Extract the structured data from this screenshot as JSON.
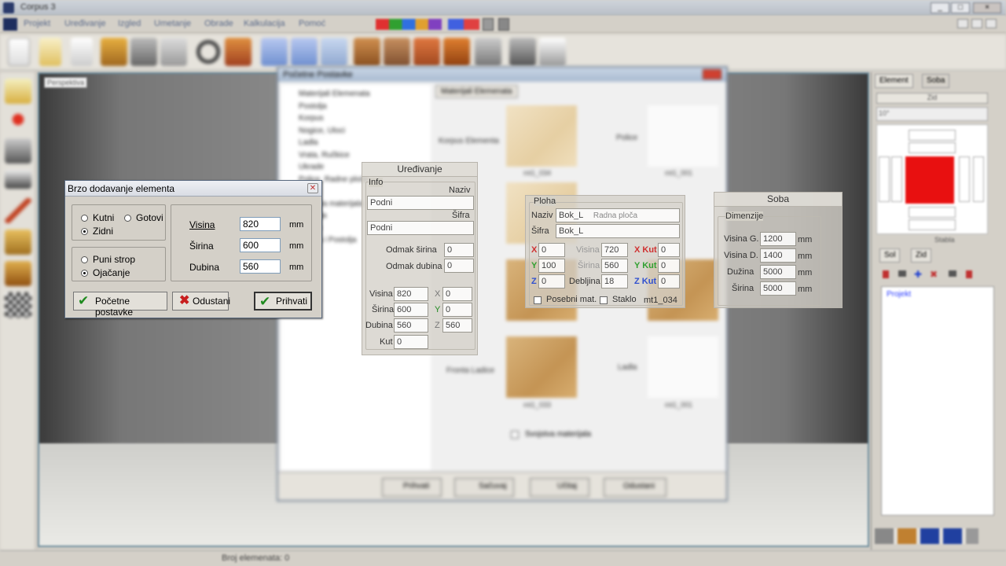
{
  "window": {
    "title": "Corpus 3",
    "controls": [
      "_",
      "□",
      "×"
    ]
  },
  "menu": [
    "Projekt",
    "Uređivanje",
    "Izgled",
    "Umetanje",
    "Obrade",
    "Kalkulacija",
    "Pomoć"
  ],
  "viewport": {
    "label": "Perspektiva"
  },
  "right_panel": {
    "tabs": [
      "Element",
      "Soba"
    ],
    "sub_tabs": [
      "Sol",
      "Zid"
    ],
    "tree_root": "Projekt",
    "tool_label": "Zid",
    "search_value": "10°",
    "state_label": "Stabla"
  },
  "status": {
    "elements": "Broj elemenata: 0"
  },
  "big_dialog": {
    "title": "Početne Postavke",
    "tree": [
      "Materijali Elemenata",
      "Postolja",
      "Korpus",
      "Nogice, Uloci",
      "Ladla",
      "Vrata, Ručkice",
      "Ukrade",
      "Police, Radne ploče",
      "Zidne",
      "Postava materijala",
      "Postolja",
      "Ladice",
      "Ispuna i Postolja"
    ],
    "tab": "Materijali Elemenata",
    "materials": [
      {
        "label": "Korpus Elementa",
        "code": "mt1_034"
      },
      {
        "label": "Police",
        "code": "mt1_001"
      },
      {
        "label": "Fronta Ladice",
        "code": "mt1_033"
      },
      {
        "label": "Ladla",
        "code": "mt1_001"
      }
    ],
    "checkbox": "Svojstva materijala",
    "buttons": [
      "Prihvati",
      "Sačuvaj",
      "Učitaj",
      "Odustani"
    ]
  },
  "uredivanje": {
    "title": "Uređivanje",
    "info_group": "Info",
    "naziv_label": "Naziv",
    "naziv": "Podni",
    "sifra_label": "Šifra",
    "sifra": "Podni",
    "odmak_sirina_label": "Odmak širina",
    "odmak_sirina": "0",
    "odmak_dubina_label": "Odmak dubina",
    "odmak_dubina": "0",
    "visina_label": "Visina",
    "visina": "820",
    "sirina_label": "Širina",
    "sirina": "600",
    "dubina_label": "Dubina",
    "dubina": "560",
    "kut_label": "Kut",
    "kut": "0",
    "x_label": "X",
    "x": "0",
    "y_label": "Y",
    "y": "0",
    "z_label": "Z",
    "z": "560"
  },
  "ploha": {
    "group": "Ploha",
    "naziv_label": "Naziv",
    "naziv": "Bok_L",
    "naziv_extra": "Radna ploča",
    "sifra_label": "Šifra",
    "sifra": "Bok_L",
    "x_label": "X",
    "x": "0",
    "y_label": "Y",
    "y": "100",
    "z_label": "Z",
    "z": "0",
    "visina_label": "Visina",
    "visina": "720",
    "sirina_label": "Širina",
    "sirina": "560",
    "debljina_label": "Debljina",
    "debljina": "18",
    "xkut_label": "X Kut",
    "xkut": "0",
    "ykut_label": "Y Kut",
    "ykut": "0",
    "zkut_label": "Z Kut",
    "zkut": "0",
    "posebni": "Posebni mat.",
    "staklo": "Staklo",
    "material": "mt1_034"
  },
  "soba": {
    "title": "Soba",
    "group": "Dimenzije",
    "rows": [
      {
        "label": "Visina G.",
        "value": "1200",
        "unit": "mm"
      },
      {
        "label": "Visina D.",
        "value": "1400",
        "unit": "mm"
      },
      {
        "label": "Dužina",
        "value": "5000",
        "unit": "mm"
      },
      {
        "label": "Širina",
        "value": "5000",
        "unit": "mm"
      }
    ]
  },
  "quick_add": {
    "title": "Brzo dodavanje elementa",
    "types": {
      "kutni": "Kutni",
      "gotovi": "Gotovi",
      "zidni": "Zidni",
      "selected": "Zidni"
    },
    "tops": {
      "puni_strop": "Puni strop",
      "ojacanje": "Ojačanje",
      "selected": "Ojačanje"
    },
    "dims": [
      {
        "label": "Visina",
        "value": "820",
        "unit": "mm"
      },
      {
        "label": "Širina",
        "value": "600",
        "unit": "mm"
      },
      {
        "label": "Dubina",
        "value": "560",
        "unit": "mm"
      }
    ],
    "buttons": {
      "defaults": "Početne postavke",
      "cancel": "Odustani",
      "accept": "Prihvati"
    }
  },
  "colors": {
    "selection_red": "#e81010",
    "tree_blue": "#2a3cff",
    "check_green": "#1f8a1f"
  }
}
